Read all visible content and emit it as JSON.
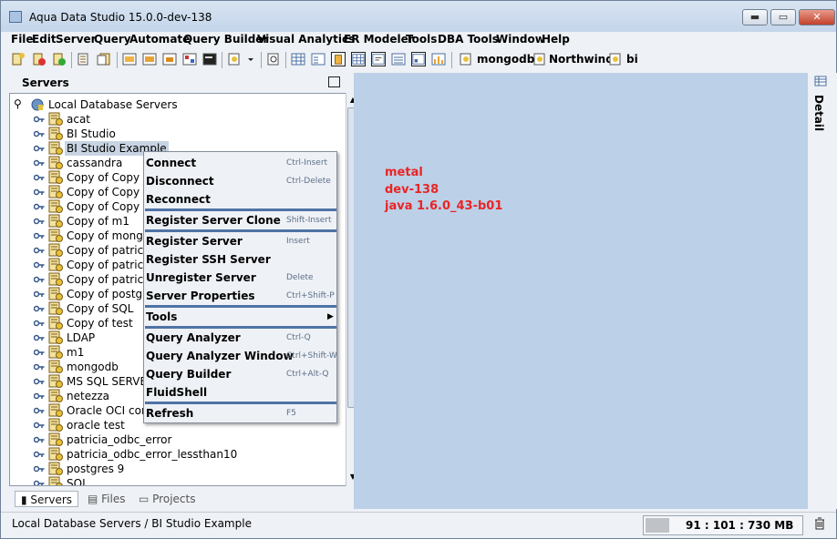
{
  "window": {
    "title": "Aqua Data Studio 15.0.0-dev-138"
  },
  "window_controls": {
    "minimize": "▬",
    "maximize": "▭",
    "close": "✕"
  },
  "menu": [
    "File",
    "Edit",
    "Server",
    "Query",
    "Automate",
    "Query Builder",
    "Visual Analytics",
    "ER Modeler",
    "Tools",
    "DBA Tools",
    "Window",
    "Help"
  ],
  "toolbar": {
    "connections": [
      "mongodb",
      "Northwind",
      "bi"
    ]
  },
  "servers_panel": {
    "title": "Servers",
    "root": "Local Database Servers",
    "items": [
      "acat",
      "BI Studio",
      "BI Studio Example",
      "cassandra",
      "Copy of Copy of a",
      "Copy of Copy of",
      "Copy of Copy of",
      "Copy of m1",
      "Copy of mongo",
      "Copy of patricia",
      "Copy of patricia",
      "Copy of patricia",
      "Copy of postgre",
      "Copy of SQL",
      "Copy of test",
      "LDAP",
      "m1",
      "mongodb",
      "MS SQL SERVE",
      "netezza",
      "Oracle OCI conn",
      "oracle test",
      "patricia_odbc_error",
      "patricia_odbc_error_lessthan10",
      "postgres 9",
      "SQL"
    ],
    "selected": "BI Studio Example",
    "tabs": [
      "Servers",
      "Files",
      "Projects"
    ]
  },
  "context_menu": {
    "groups": [
      [
        {
          "label": "Connect",
          "shortcut": "Ctrl-Insert"
        },
        {
          "label": "Disconnect",
          "shortcut": "Ctrl-Delete"
        },
        {
          "label": "Reconnect",
          "shortcut": ""
        }
      ],
      [
        {
          "label": "Register Server Clone",
          "shortcut": "Shift-Insert"
        }
      ],
      [
        {
          "label": "Register Server",
          "shortcut": "Insert"
        },
        {
          "label": "Register SSH Server",
          "shortcut": ""
        },
        {
          "label": "Unregister Server",
          "shortcut": "Delete"
        },
        {
          "label": "Server Properties",
          "shortcut": "Ctrl+Shift-P"
        }
      ],
      [
        {
          "label": "Tools",
          "shortcut": ""
        }
      ],
      [
        {
          "label": "Query Analyzer",
          "shortcut": "Ctrl-Q"
        },
        {
          "label": "Query Analyzer Window",
          "shortcut": "Ctrl+Shift-W"
        },
        {
          "label": "Query Builder",
          "shortcut": "Ctrl+Alt-Q"
        },
        {
          "label": "FluidShell",
          "shortcut": ""
        }
      ],
      [
        {
          "label": "Refresh",
          "shortcut": "F5"
        }
      ]
    ]
  },
  "main_area": {
    "info_lines": [
      "metal",
      "dev-138",
      "java 1.6.0_43-b01"
    ]
  },
  "detail_panel": {
    "label": "Detail"
  },
  "statusbar": {
    "path": "Local Database Servers / BI Studio Example",
    "memory": "91 : 101 : 730 MB"
  },
  "colors": {
    "info_text": "#e82525",
    "main_bg": "#bcd0e7",
    "separator": "#4f73a6"
  }
}
